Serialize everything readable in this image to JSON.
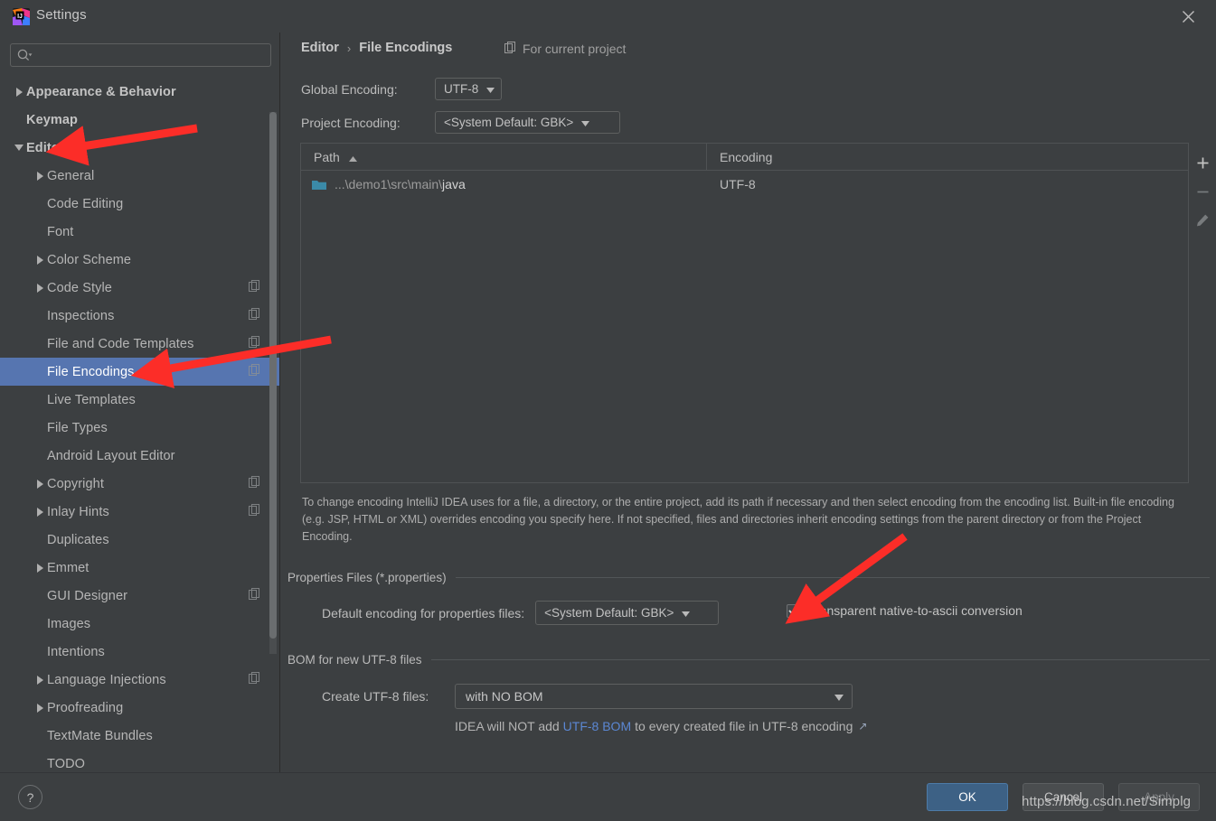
{
  "window": {
    "title": "Settings",
    "app_icon": "intellij-idea-icon",
    "close_icon": "close-icon"
  },
  "sidebar": {
    "search": {
      "placeholder": "",
      "value": "",
      "icon": "search-icon"
    },
    "items": [
      {
        "label": "Appearance & Behavior",
        "indent": 0,
        "arrow": "collapsed",
        "bold": true,
        "badge": false,
        "selected": false
      },
      {
        "label": "Keymap",
        "indent": 0,
        "arrow": "none",
        "bold": true,
        "badge": false,
        "selected": false
      },
      {
        "label": "Editor",
        "indent": 0,
        "arrow": "expanded",
        "bold": true,
        "badge": false,
        "selected": false
      },
      {
        "label": "General",
        "indent": 1,
        "arrow": "collapsed",
        "bold": false,
        "badge": false,
        "selected": false
      },
      {
        "label": "Code Editing",
        "indent": 1,
        "arrow": "none",
        "bold": false,
        "badge": false,
        "selected": false
      },
      {
        "label": "Font",
        "indent": 1,
        "arrow": "none",
        "bold": false,
        "badge": false,
        "selected": false
      },
      {
        "label": "Color Scheme",
        "indent": 1,
        "arrow": "collapsed",
        "bold": false,
        "badge": false,
        "selected": false
      },
      {
        "label": "Code Style",
        "indent": 1,
        "arrow": "collapsed",
        "bold": false,
        "badge": true,
        "selected": false
      },
      {
        "label": "Inspections",
        "indent": 1,
        "arrow": "none",
        "bold": false,
        "badge": true,
        "selected": false
      },
      {
        "label": "File and Code Templates",
        "indent": 1,
        "arrow": "none",
        "bold": false,
        "badge": true,
        "selected": false
      },
      {
        "label": "File Encodings",
        "indent": 1,
        "arrow": "none",
        "bold": false,
        "badge": true,
        "selected": true
      },
      {
        "label": "Live Templates",
        "indent": 1,
        "arrow": "none",
        "bold": false,
        "badge": false,
        "selected": false
      },
      {
        "label": "File Types",
        "indent": 1,
        "arrow": "none",
        "bold": false,
        "badge": false,
        "selected": false
      },
      {
        "label": "Android Layout Editor",
        "indent": 1,
        "arrow": "none",
        "bold": false,
        "badge": false,
        "selected": false
      },
      {
        "label": "Copyright",
        "indent": 1,
        "arrow": "collapsed",
        "bold": false,
        "badge": true,
        "selected": false
      },
      {
        "label": "Inlay Hints",
        "indent": 1,
        "arrow": "collapsed",
        "bold": false,
        "badge": true,
        "selected": false
      },
      {
        "label": "Duplicates",
        "indent": 1,
        "arrow": "none",
        "bold": false,
        "badge": false,
        "selected": false
      },
      {
        "label": "Emmet",
        "indent": 1,
        "arrow": "collapsed",
        "bold": false,
        "badge": false,
        "selected": false
      },
      {
        "label": "GUI Designer",
        "indent": 1,
        "arrow": "none",
        "bold": false,
        "badge": true,
        "selected": false
      },
      {
        "label": "Images",
        "indent": 1,
        "arrow": "none",
        "bold": false,
        "badge": false,
        "selected": false
      },
      {
        "label": "Intentions",
        "indent": 1,
        "arrow": "none",
        "bold": false,
        "badge": false,
        "selected": false
      },
      {
        "label": "Language Injections",
        "indent": 1,
        "arrow": "collapsed",
        "bold": false,
        "badge": true,
        "selected": false
      },
      {
        "label": "Proofreading",
        "indent": 1,
        "arrow": "collapsed",
        "bold": false,
        "badge": false,
        "selected": false
      },
      {
        "label": "TextMate Bundles",
        "indent": 1,
        "arrow": "none",
        "bold": false,
        "badge": false,
        "selected": false
      },
      {
        "label": "TODO",
        "indent": 1,
        "arrow": "none",
        "bold": false,
        "badge": false,
        "selected": false
      }
    ]
  },
  "main": {
    "breadcrumb": {
      "parent": "Editor",
      "separator": "›",
      "current": "File Encodings"
    },
    "for_current_project": "For current project",
    "global_encoding": {
      "label": "Global Encoding:",
      "value": "UTF-8"
    },
    "project_encoding": {
      "label": "Project Encoding:",
      "value": "<System Default: GBK>"
    },
    "table": {
      "columns": [
        "Path",
        "Encoding"
      ],
      "sort_column": "Path",
      "sort_direction": "ascending",
      "rows": [
        {
          "path_prefix": "...\\demo1\\src\\main\\",
          "path_leaf": "java",
          "encoding": "UTF-8"
        }
      ],
      "toolbar": [
        "add-icon",
        "remove-icon",
        "edit-icon"
      ]
    },
    "description": "To change encoding IntelliJ IDEA uses for a file, a directory, or the entire project, add its path if necessary and then select encoding from the encoding list. Built-in file encoding (e.g. JSP, HTML or XML) overrides encoding you specify here. If not specified, files and directories inherit encoding settings from the parent directory or from the Project Encoding.",
    "properties_group": {
      "title": "Properties Files (*.properties)",
      "default_encoding_label": "Default encoding for properties files:",
      "default_encoding_value": "<System Default: GBK>",
      "transparent_label": "Transparent native-to-ascii conversion",
      "transparent_checked": true
    },
    "bom_group": {
      "title": "BOM for new UTF-8 files",
      "create_label": "Create UTF-8 files:",
      "create_value": "with NO BOM",
      "hint_prefix": "IDEA will NOT add",
      "hint_link": "UTF-8 BOM",
      "hint_suffix": "to every created file in UTF-8 encoding"
    }
  },
  "footer": {
    "help": "?",
    "ok": "OK",
    "cancel": "Cancel",
    "apply": "Apply"
  },
  "watermark": "https://blog.csdn.net/Simplg",
  "colors": {
    "window_bg": "#3c3f41",
    "selection_blue": "#5675b0",
    "ok_button": "#3d6185",
    "link_blue": "#5b87d3",
    "folder_teal": "#3b8aa8",
    "annotation_red": "#fc2d28"
  }
}
